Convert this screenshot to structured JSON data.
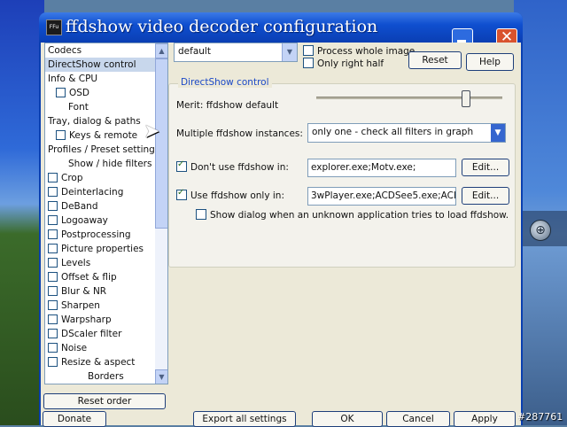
{
  "window": {
    "title": "ffdshow video decoder configuration",
    "icon_text": "FFu"
  },
  "tree": {
    "items": [
      {
        "label": "Codecs",
        "indent": 0,
        "checkbox": false,
        "selected": false
      },
      {
        "label": "DirectShow control",
        "indent": 0,
        "checkbox": false,
        "selected": true
      },
      {
        "label": "Info & CPU",
        "indent": 0,
        "checkbox": false,
        "selected": false
      },
      {
        "label": "OSD",
        "indent": 1,
        "checkbox": true,
        "selected": false
      },
      {
        "label": "Font",
        "indent": 2,
        "checkbox": false,
        "selected": false
      },
      {
        "label": "Tray, dialog & paths",
        "indent": 0,
        "checkbox": false,
        "selected": false
      },
      {
        "label": "Keys & remote",
        "indent": 1,
        "checkbox": true,
        "selected": false
      },
      {
        "label": "Profiles / Preset settings",
        "indent": 0,
        "checkbox": false,
        "selected": false
      },
      {
        "label": "Show / hide filters",
        "indent": 2,
        "checkbox": false,
        "selected": false
      },
      {
        "label": "Crop",
        "indent": 0,
        "checkbox": true,
        "selected": false
      },
      {
        "label": "Deinterlacing",
        "indent": 0,
        "checkbox": true,
        "selected": false
      },
      {
        "label": "DeBand",
        "indent": 0,
        "checkbox": true,
        "selected": false
      },
      {
        "label": "Logoaway",
        "indent": 0,
        "checkbox": true,
        "selected": false
      },
      {
        "label": "Postprocessing",
        "indent": 0,
        "checkbox": true,
        "selected": false
      },
      {
        "label": "Picture properties",
        "indent": 0,
        "checkbox": true,
        "selected": false
      },
      {
        "label": "Levels",
        "indent": 0,
        "checkbox": true,
        "selected": false
      },
      {
        "label": "Offset & flip",
        "indent": 0,
        "checkbox": true,
        "selected": false
      },
      {
        "label": "Blur & NR",
        "indent": 0,
        "checkbox": true,
        "selected": false
      },
      {
        "label": "Sharpen",
        "indent": 0,
        "checkbox": true,
        "selected": false
      },
      {
        "label": "Warpsharp",
        "indent": 0,
        "checkbox": true,
        "selected": false
      },
      {
        "label": "DScaler filter",
        "indent": 0,
        "checkbox": true,
        "selected": false
      },
      {
        "label": "Noise",
        "indent": 0,
        "checkbox": true,
        "selected": false
      },
      {
        "label": "Resize & aspect",
        "indent": 0,
        "checkbox": true,
        "selected": false
      },
      {
        "label": "Borders",
        "indent": 3,
        "checkbox": false,
        "selected": false
      }
    ],
    "reset_order_label": "Reset order"
  },
  "top": {
    "preset_value": "default",
    "process_whole_image_label": "Process whole image",
    "process_whole_image_checked": false,
    "only_right_half_label": "Only right half",
    "only_right_half_checked": false,
    "reset_label": "Reset",
    "help_label": "Help"
  },
  "directshow": {
    "group_title": "DirectShow control",
    "merit_label": "Merit: ffdshow default",
    "merit_level": 0.8,
    "instances_label": "Multiple ffdshow instances:",
    "instances_value": "only one - check all filters in graph",
    "dont_use_label": "Don't use ffdshow in:",
    "dont_use_checked": true,
    "dont_use_value": "explorer.exe;Motv.exe;",
    "use_only_label": "Use ffdshow only in:",
    "use_only_checked": true,
    "use_only_value": "3wPlayer.exe;ACDSee5.exe;ACDS",
    "edit_label": "Edit...",
    "show_dialog_label": "Show dialog when an unknown application tries to load ffdshow.",
    "show_dialog_checked": false
  },
  "footer": {
    "donate_label": "Donate",
    "export_label": "Export all settings",
    "ok_label": "OK",
    "cancel_label": "Cancel",
    "apply_label": "Apply"
  },
  "watermark": "#287761"
}
